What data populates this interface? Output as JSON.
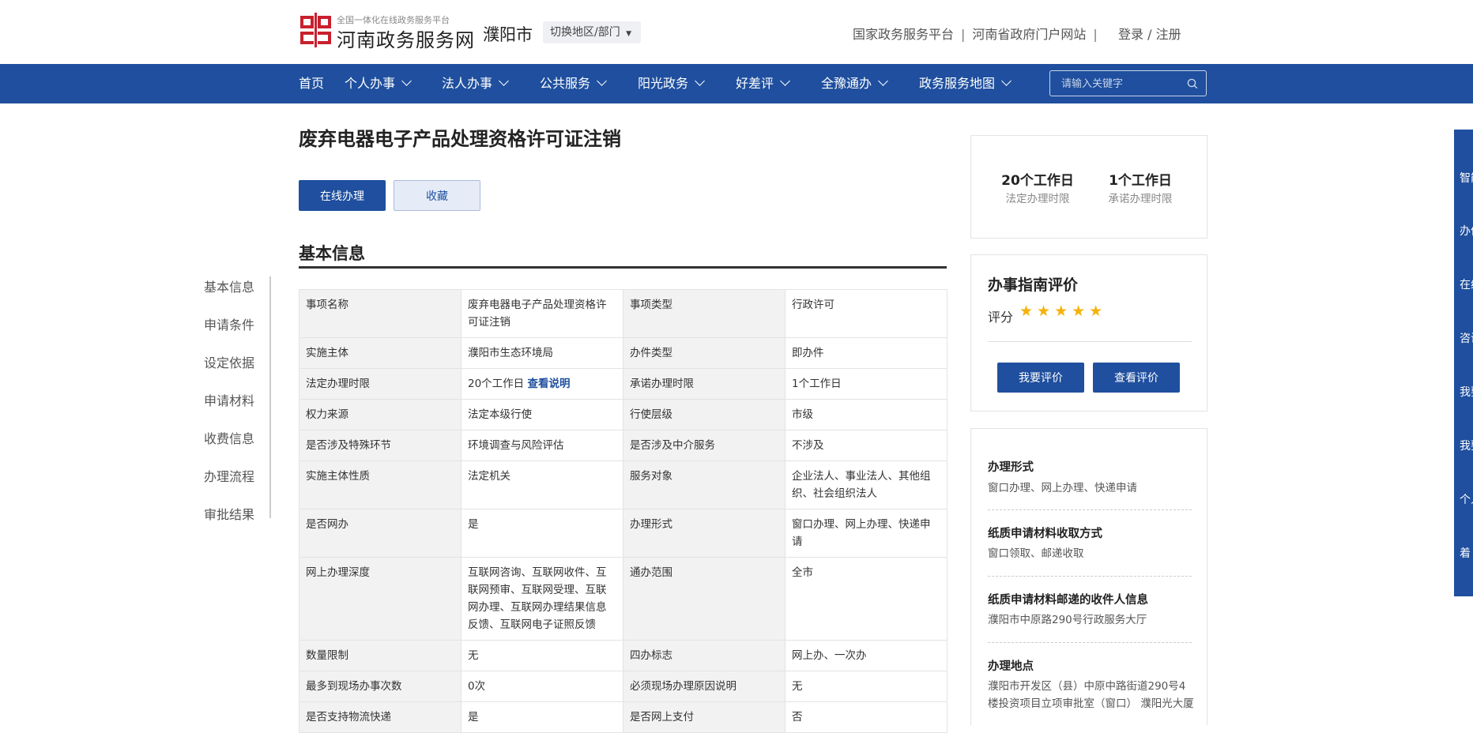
{
  "header": {
    "logo_small": "全国一体化在线政务服务平台",
    "logo_big": "河南政务服务网",
    "city": "濮阳市",
    "switch_label": "切换地区/部门",
    "links": [
      "国家政务服务平台",
      "河南省政府门户网站"
    ],
    "login": "登录 / 注册"
  },
  "nav": {
    "items": [
      "首页",
      "个人办事",
      "法人办事",
      "公共服务",
      "阳光政务",
      "好差评",
      "全豫通办",
      "政务服务地图"
    ],
    "search_placeholder": "请输入关键字"
  },
  "page": {
    "title": "废弃电器电子产品处理资格许可证注销",
    "online_button": "在线办理",
    "favorite_button": "收藏",
    "section_title": "基本信息"
  },
  "side_nav": [
    "基本信息",
    "申请条件",
    "设定依据",
    "申请材料",
    "收费信息",
    "办理流程",
    "审批结果"
  ],
  "table": {
    "rows": [
      [
        "事项名称",
        "废弃电器电子产品处理资格许可证注销",
        "事项类型",
        "行政许可"
      ],
      [
        "实施主体",
        "濮阳市生态环境局",
        "办件类型",
        "即办件"
      ],
      [
        "法定办理时限",
        "20个工作日",
        "承诺办理时限",
        "1个工作日"
      ],
      [
        "权力来源",
        "法定本级行使",
        "行使层级",
        "市级"
      ],
      [
        "是否涉及特殊环节",
        "环境调查与风险评估",
        "是否涉及中介服务",
        "不涉及"
      ],
      [
        "实施主体性质",
        "法定机关",
        "服务对象",
        "企业法人、事业法人、其他组织、社会组织法人"
      ],
      [
        "是否网办",
        "是",
        "办理形式",
        "窗口办理、网上办理、快递申请"
      ],
      [
        "网上办理深度",
        "互联网咨询、互联网收件、互联网预审、互联网受理、互联网办理、互联网办理结果信息反馈、互联网电子证照反馈",
        "通办范围",
        "全市"
      ],
      [
        "数量限制",
        "无",
        "四办标志",
        "网上办、一次办"
      ],
      [
        "最多到现场办事次数",
        "0次",
        "必须现场办理原因说明",
        "无"
      ],
      [
        "是否支持物流快递",
        "是",
        "是否网上支付",
        "否"
      ]
    ],
    "view_link": "查看说明"
  },
  "stats": {
    "legal_value": "20个工作日",
    "legal_label": "法定办理时限",
    "promise_value": "1个工作日",
    "promise_label": "承诺办理时限"
  },
  "evaluation": {
    "title": "办事指南评价",
    "score_label": "评分",
    "stars": "★★★★★",
    "rating": 5,
    "rate_button": "我要评价",
    "view_button": "查看评价"
  },
  "side_info": [
    {
      "heading": "办理形式",
      "value": "窗口办理、网上办理、快递申请"
    },
    {
      "heading": "纸质申请材料收取方式",
      "value": "窗口领取、邮递收取"
    },
    {
      "heading": "纸质申请材料邮递的收件人信息",
      "value": "濮阳市中原路290号行政服务大厅"
    },
    {
      "heading": "办理地点",
      "value": "濮阳市开发区（县）中原中路街道290号4楼投资项目立项审批室（窗口） 濮阳光大厦"
    }
  ],
  "float_bar": [
    "智能",
    "办件",
    "在线",
    "咨询",
    "我要",
    "我要",
    "个人",
    "着"
  ]
}
